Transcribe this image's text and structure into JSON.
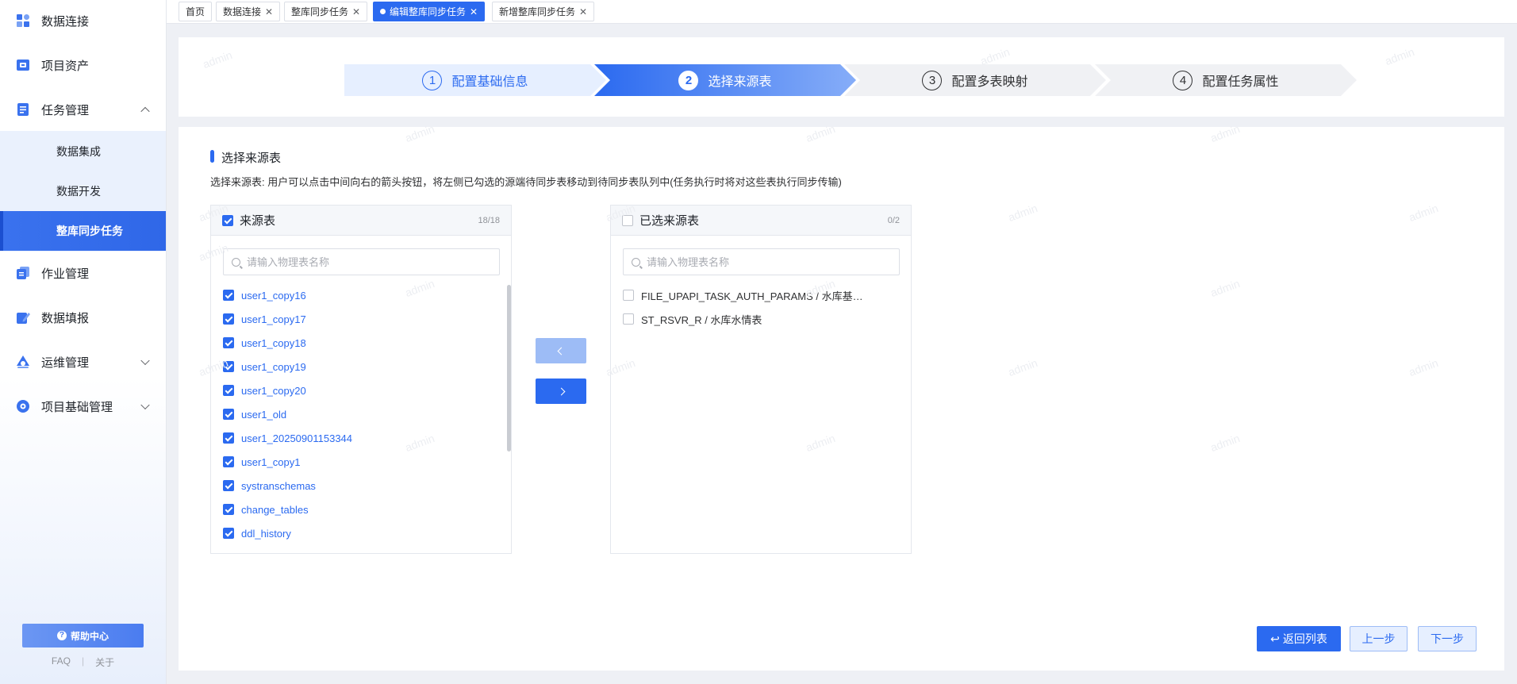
{
  "sidebar": {
    "items": [
      {
        "label": "数据连接",
        "icon": "data-connection-icon"
      },
      {
        "label": "项目资产",
        "icon": "project-asset-icon"
      },
      {
        "label": "任务管理",
        "icon": "task-management-icon",
        "expanded": true
      },
      {
        "label": "作业管理",
        "icon": "job-management-icon"
      },
      {
        "label": "数据填报",
        "icon": "data-report-icon"
      },
      {
        "label": "运维管理",
        "icon": "ops-management-icon"
      },
      {
        "label": "项目基础管理",
        "icon": "project-base-icon"
      }
    ],
    "subitems": [
      {
        "label": "数据集成"
      },
      {
        "label": "数据开发"
      },
      {
        "label": "整库同步任务",
        "active": true
      }
    ],
    "help_label": "帮助中心",
    "faq_label": "FAQ",
    "about_label": "关于"
  },
  "tabs": [
    {
      "label": "首页",
      "closable": false
    },
    {
      "label": "数据连接",
      "closable": true
    },
    {
      "label": "整库同步任务",
      "closable": true
    },
    {
      "label": "编辑整库同步任务",
      "closable": true,
      "active": true
    },
    {
      "label": "新增整库同步任务",
      "closable": true
    }
  ],
  "steps": [
    {
      "num": "1",
      "label": "配置基础信息",
      "state": "done"
    },
    {
      "num": "2",
      "label": "选择来源表",
      "state": "current"
    },
    {
      "num": "3",
      "label": "配置多表映射",
      "state": "todo"
    },
    {
      "num": "4",
      "label": "配置任务属性",
      "state": "todo"
    }
  ],
  "section": {
    "title": "选择来源表",
    "description": "选择来源表: 用户可以点击中间向右的箭头按钮，将左侧已勾选的源端待同步表移动到待同步表队列中(任务执行时将对这些表执行同步传输)"
  },
  "source_panel": {
    "title": "来源表",
    "count": "18/18",
    "search_placeholder": "请输入物理表名称",
    "items": [
      "user1_copy16",
      "user1_copy17",
      "user1_copy18",
      "user1_copy19",
      "user1_copy20",
      "user1_old",
      "user1_20250901153344",
      "user1_copy1",
      "systranschemas",
      "change_tables",
      "ddl_history"
    ]
  },
  "target_panel": {
    "title": "已选来源表",
    "count": "0/2",
    "search_placeholder": "请输入物理表名称",
    "items": [
      "FILE_UPAPI_TASK_AUTH_PARAMS / 水库基…",
      "ST_RSVR_R / 水库水情表"
    ]
  },
  "footer": {
    "back_label": "返回列表",
    "prev_label": "上一步",
    "next_label": "下一步"
  },
  "watermark": "admin",
  "colors": {
    "primary": "#2b6af0",
    "primary_light": "#e6efff"
  }
}
